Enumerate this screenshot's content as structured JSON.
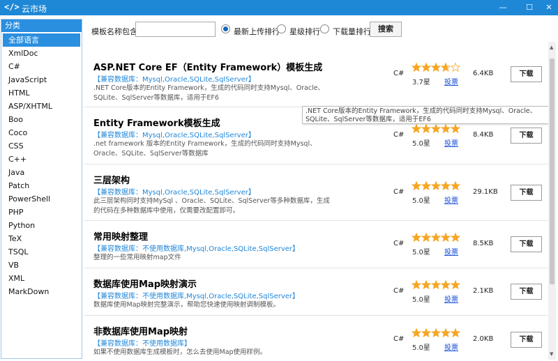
{
  "window": {
    "title": "云市场",
    "icon": "</>",
    "minimize": "—",
    "maximize": "☐",
    "close": "✕"
  },
  "sidebar": {
    "header": "分类",
    "items": [
      "全部语言",
      "XmlDoc",
      "C#",
      "JavaScript",
      "HTML",
      "ASP/XHTML",
      "Boo",
      "Coco",
      "CSS",
      "C++",
      "Java",
      "Patch",
      "PowerShell",
      "PHP",
      "Python",
      "TeX",
      "TSQL",
      "VB",
      "XML",
      "MarkDown"
    ],
    "selected_index": 0
  },
  "search": {
    "label": "模板名称包含:",
    "value": "",
    "sort_options": [
      "最新上传排行",
      "星级排行",
      "下载量排行"
    ],
    "selected_sort": 0,
    "button": "搜索"
  },
  "templates": [
    {
      "title": "ASP.NET Core EF（Entity Framework）模板生成",
      "db": "【兼容数据库：Mysql,Oracle,SQLite,SqlServer】",
      "desc": ".NET Core版本的Entity Framework，生成的代码同时支持Mysql、Oracle、SQLite、SqlServer等数据库，适用于EF6",
      "lang": "C#",
      "stars": 3.7,
      "rating": "3.7星",
      "vote": "投票",
      "size": "6.4KB",
      "download": "下载"
    },
    {
      "title": "Entity Framework模板生成",
      "db": "【兼容数据库：Mysql,Oracle,SQLite,SqlServer】",
      "desc": ".net framework 版本的Entity Framework，生成的代码同时支持Mysql、Oracle、SQLite、SqlServer等数据库",
      "lang": "C#",
      "stars": 5.0,
      "rating": "5.0星",
      "vote": "投票",
      "size": "8.4KB",
      "download": "下载"
    },
    {
      "title": "三层架构",
      "db": "【兼容数据库：Mysql,Oracle,SQLite,SqlServer】",
      "desc": "此三层架构同时支持MySql 、Oracle、SQLite、SqlServer等多种数据库，生成的代码在多种数据库中使用，仅需要改配置即可。",
      "lang": "C#",
      "stars": 5.0,
      "rating": "5.0星",
      "vote": "投票",
      "size": "29.1KB",
      "download": "下载"
    },
    {
      "title": "常用映射整理",
      "db": "【兼容数据库：不使用数据库,Mysql,Oracle,SQLite,SqlServer】",
      "desc": "整理的一些常用映射map文件",
      "lang": "C#",
      "stars": 5.0,
      "rating": "5.0星",
      "vote": "投票",
      "size": "8.5KB",
      "download": "下载"
    },
    {
      "title": "数据库使用Map映射演示",
      "db": "【兼容数据库：不使用数据库,Mysql,Oracle,SQLite,SqlServer】",
      "desc": "数据库使用Map映射完整演示，帮助您快速使用映射调制模板。",
      "lang": "C#",
      "stars": 5.0,
      "rating": "5.0星",
      "vote": "投票",
      "size": "2.1KB",
      "download": "下载"
    },
    {
      "title": "非数据库使用Map映射",
      "db": "【兼容数据库：不使用数据库】",
      "desc": "如果不使用数据库生成模板时，怎么去使用Map使用样例。",
      "lang": "C#",
      "stars": 5.0,
      "rating": "5.0星",
      "vote": "投票",
      "size": "2.0KB",
      "download": "下载"
    }
  ],
  "tooltip": ".NET Core版本的Entity Framework，生成的代码同时支持Mysql、Oracle、SQLite、SqlServer等数据库，适用于EF6",
  "colors": {
    "accent": "#1e88d6",
    "star": "#f5a623",
    "link": "#1a4fd6",
    "db_text": "#1f86d8"
  },
  "scrollbar": {
    "up": "▲",
    "down": "▼"
  }
}
